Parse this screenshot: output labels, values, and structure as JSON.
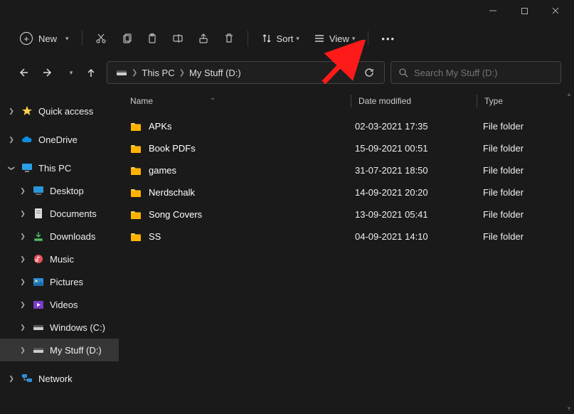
{
  "titlebar": {
    "min": "—",
    "max": "☐",
    "close": "✕"
  },
  "toolbar": {
    "new": "New",
    "sort": "Sort",
    "view": "View"
  },
  "breadcrumb": {
    "root": "This PC",
    "current": "My Stuff (D:)"
  },
  "search": {
    "placeholder": "Search My Stuff (D:)"
  },
  "sidebar": {
    "quick": "Quick access",
    "onedrive": "OneDrive",
    "thispc": "This PC",
    "desktop": "Desktop",
    "documents": "Documents",
    "downloads": "Downloads",
    "music": "Music",
    "pictures": "Pictures",
    "videos": "Videos",
    "winc": "Windows (C:)",
    "mystuff": "My Stuff (D:)",
    "network": "Network"
  },
  "columns": {
    "name": "Name",
    "date": "Date modified",
    "type": "Type"
  },
  "rows": [
    {
      "name": "APKs",
      "date": "02-03-2021 17:35",
      "type": "File folder"
    },
    {
      "name": "Book PDFs",
      "date": "15-09-2021 00:51",
      "type": "File folder"
    },
    {
      "name": "games",
      "date": "31-07-2021 18:50",
      "type": "File folder"
    },
    {
      "name": "Nerdschalk",
      "date": "14-09-2021 20:20",
      "type": "File folder"
    },
    {
      "name": "Song Covers",
      "date": "13-09-2021 05:41",
      "type": "File folder"
    },
    {
      "name": "SS",
      "date": "04-09-2021 14:10",
      "type": "File folder"
    }
  ]
}
